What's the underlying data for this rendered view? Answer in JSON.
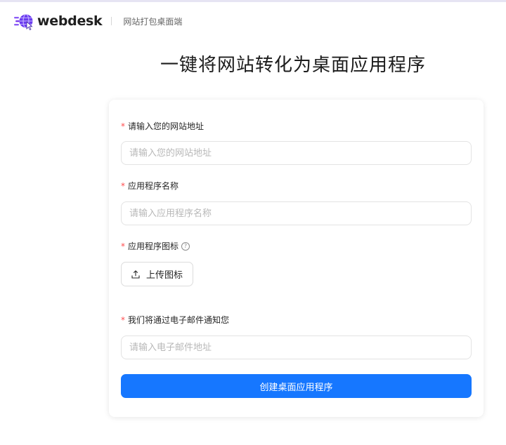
{
  "header": {
    "brand": "webdesk",
    "subtitle": "网站打包桌面端"
  },
  "hero": {
    "title": "一键将网站转化为桌面应用程序"
  },
  "form": {
    "required_mark": "*",
    "website": {
      "label": "请输入您的网站地址",
      "placeholder": "请输入您的网站地址",
      "value": ""
    },
    "app_name": {
      "label": "应用程序名称",
      "placeholder": "请输入应用程序名称",
      "value": ""
    },
    "app_icon": {
      "label": "应用程序图标",
      "help_glyph": "?",
      "upload_label": "上传图标"
    },
    "email": {
      "label": "我们将通过电子邮件通知您",
      "placeholder": "请输入电子邮件地址",
      "value": ""
    },
    "submit_label": "创建桌面应用程序"
  },
  "colors": {
    "primary": "#1677ff",
    "required": "#ff4d4f",
    "brand_purple": "#6b3cf0"
  },
  "icons": {
    "logo": "globe-cursor-logo-icon",
    "help": "question-circle-icon",
    "upload": "upload-icon"
  }
}
